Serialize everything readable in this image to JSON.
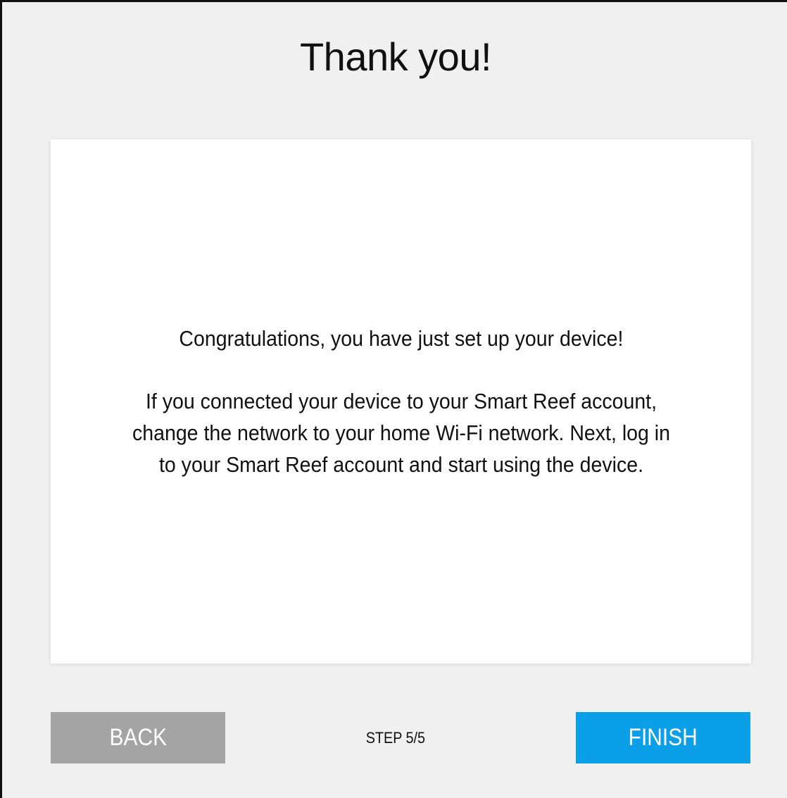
{
  "page": {
    "title": "Thank you!"
  },
  "card": {
    "congrats_text": "Congratulations, you have just set up your device!",
    "instructions_line1": "If you connected your device to your Smart Reef account,",
    "instructions_line2": "change the network to your home Wi-Fi network. Next, log in",
    "instructions_line3": "to your Smart Reef account and start using the device."
  },
  "footer": {
    "back_label": "BACK",
    "step_label": "STEP 5/5",
    "finish_label": "FINISH"
  },
  "colors": {
    "background": "#f0f0f0",
    "card": "#ffffff",
    "back_button": "#a4a4a4",
    "finish_button": "#0b9fe8",
    "text": "#111111"
  }
}
